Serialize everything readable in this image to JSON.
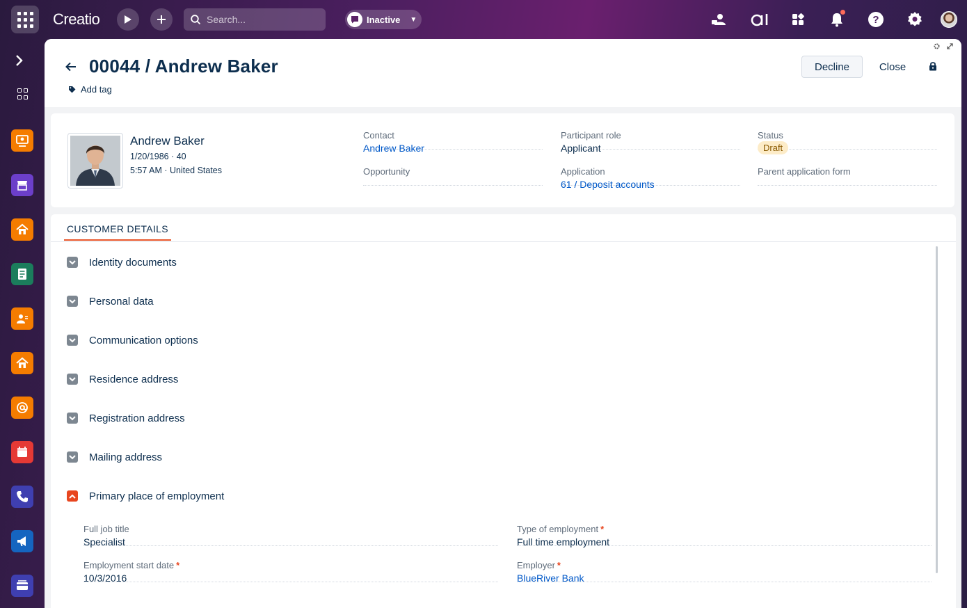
{
  "topbar": {
    "logo": "Creatio",
    "search_placeholder": "Search...",
    "status_pill": "Inactive"
  },
  "header": {
    "title": "00044 / Andrew Baker",
    "add_tag": "Add tag",
    "decline_label": "Decline",
    "close_label": "Close"
  },
  "profile": {
    "name": "Andrew Baker",
    "birth_age": "1/20/1986 · 40",
    "time_location": "5:57 AM · United States"
  },
  "fields": {
    "contact_label": "Contact",
    "contact_value": "Andrew Baker",
    "participant_role_label": "Participant role",
    "participant_role_value": "Applicant",
    "status_label": "Status",
    "status_value": "Draft",
    "opportunity_label": "Opportunity",
    "application_label": "Application",
    "application_value": "61 / Deposit accounts",
    "parent_form_label": "Parent application form"
  },
  "details": {
    "tab": "CUSTOMER DETAILS",
    "sections": [
      "Identity documents",
      "Personal data",
      "Communication options",
      "Residence address",
      "Registration address",
      "Mailing address",
      "Primary place of employment"
    ],
    "employment": {
      "job_title_label": "Full job title",
      "job_title_value": "Specialist",
      "type_label": "Type of employment",
      "type_value": "Full time employment",
      "start_date_label": "Employment start date",
      "start_date_value": "10/3/2016",
      "employer_label": "Employer",
      "employer_value": "BlueRiver Bank"
    }
  },
  "colors": {
    "accent": "#e8461f",
    "link": "#0058c8",
    "text": "#0d2e4e"
  }
}
